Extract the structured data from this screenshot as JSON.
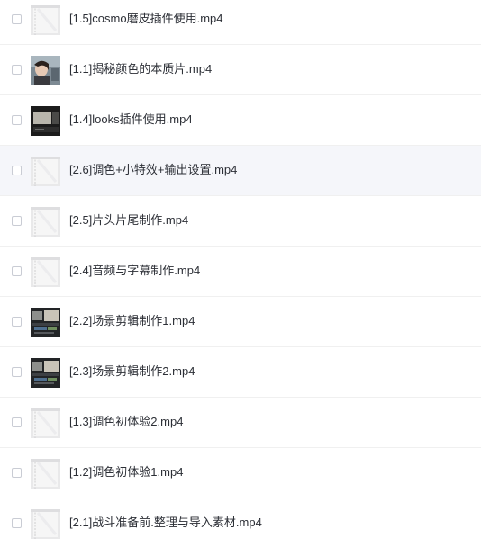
{
  "files": [
    {
      "name": "[1.5]cosmo磨皮插件使用.mp4",
      "thumbnail": "blank-video-thumbnail",
      "selected": false
    },
    {
      "name": "[1.1]揭秘颜色的本质片.mp4",
      "thumbnail": "portrait-video-thumbnail",
      "selected": false
    },
    {
      "name": "[1.4]looks插件使用.mp4",
      "thumbnail": "dark-screen-video-thumbnail",
      "selected": false
    },
    {
      "name": "[2.6]调色+小特效+输出设置.mp4",
      "thumbnail": "blank-video-thumbnail",
      "selected": false
    },
    {
      "name": "[2.5]片头片尾制作.mp4",
      "thumbnail": "blank-video-thumbnail",
      "selected": false
    },
    {
      "name": "[2.4]音频与字幕制作.mp4",
      "thumbnail": "blank-video-thumbnail",
      "selected": false
    },
    {
      "name": "[2.2]场景剪辑制作1.mp4",
      "thumbnail": "editor-screen-video-thumbnail",
      "selected": false
    },
    {
      "name": "[2.3]场景剪辑制作2.mp4",
      "thumbnail": "editor-screen-video-thumbnail",
      "selected": false
    },
    {
      "name": "[1.3]调色初体验2.mp4",
      "thumbnail": "blank-video-thumbnail",
      "selected": false
    },
    {
      "name": "[1.2]调色初体验1.mp4",
      "thumbnail": "blank-video-thumbnail",
      "selected": false
    },
    {
      "name": "[2.1]战斗准备前.整理与导入素材.mp4",
      "thumbnail": "blank-video-thumbnail",
      "selected": false
    }
  ],
  "highlighted_row": 3,
  "colors": {
    "text": "#2c2f36",
    "row_highlight": "#f5f6fa",
    "divider": "#f0f0f0",
    "checkbox_border": "#c9ccd4"
  }
}
